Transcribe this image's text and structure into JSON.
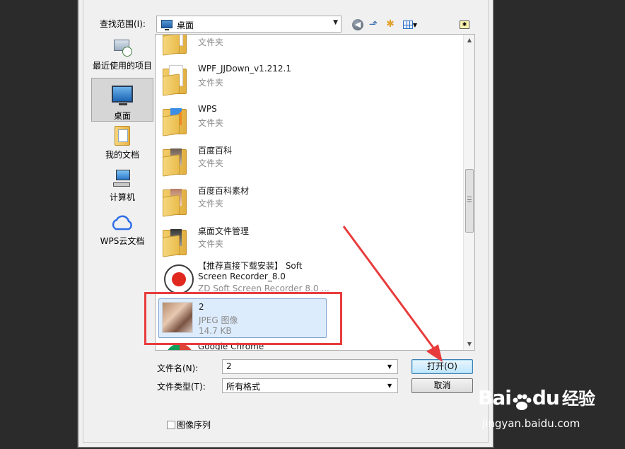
{
  "toolbar": {
    "look_in_label": "查找范围(I):",
    "look_in_value": "桌面"
  },
  "places": [
    {
      "label": "最近使用的项目",
      "icon": "recent-items-icon"
    },
    {
      "label": "桌面",
      "icon": "desktop-icon",
      "selected": true
    },
    {
      "label": "我的文档",
      "icon": "my-documents-icon"
    },
    {
      "label": "计算机",
      "icon": "computer-icon"
    },
    {
      "label": "WPS云文档",
      "icon": "wps-cloud-icon"
    }
  ],
  "files": [
    {
      "name": "",
      "sub": "文件夹",
      "icon": "folder-icon"
    },
    {
      "name": "WPF_JJDown_v1.212.1",
      "sub": "文件夹",
      "icon": "folder-icon"
    },
    {
      "name": "WPS",
      "sub": "文件夹",
      "icon": "folder-icon"
    },
    {
      "name": "百度百科",
      "sub": "文件夹",
      "icon": "folder-icon"
    },
    {
      "name": "百度百科素材",
      "sub": "文件夹",
      "icon": "folder-icon"
    },
    {
      "name": "桌面文件管理",
      "sub": "文件夹",
      "icon": "folder-icon"
    },
    {
      "name": "【推荐直接下载安装】 Soft",
      "name2": "Screen Recorder_8.0",
      "sub": "ZD Soft Screen Recorder 8.0 ...",
      "icon": "recorder-icon"
    },
    {
      "name": "2",
      "sub": "JPEG 图像",
      "size": "14.7 KB",
      "icon": "image-thumbnail",
      "selected": true
    },
    {
      "name": "Google Chrome",
      "icon": "chrome-icon"
    }
  ],
  "bottom": {
    "file_name_label": "文件名(N):",
    "file_name_value": "2",
    "file_type_label": "文件类型(T):",
    "file_type_value": "所有格式",
    "open_button": "打开(O)",
    "cancel_button": "取消",
    "image_sequence_label": "图像序列"
  },
  "watermark": {
    "brand_left": "Bai",
    "brand_right": "du",
    "brand_cn": "经验",
    "url": "jingyan.baidu.com"
  },
  "colors": {
    "highlight": "#e83c3c",
    "selection": "#ddecfd"
  }
}
